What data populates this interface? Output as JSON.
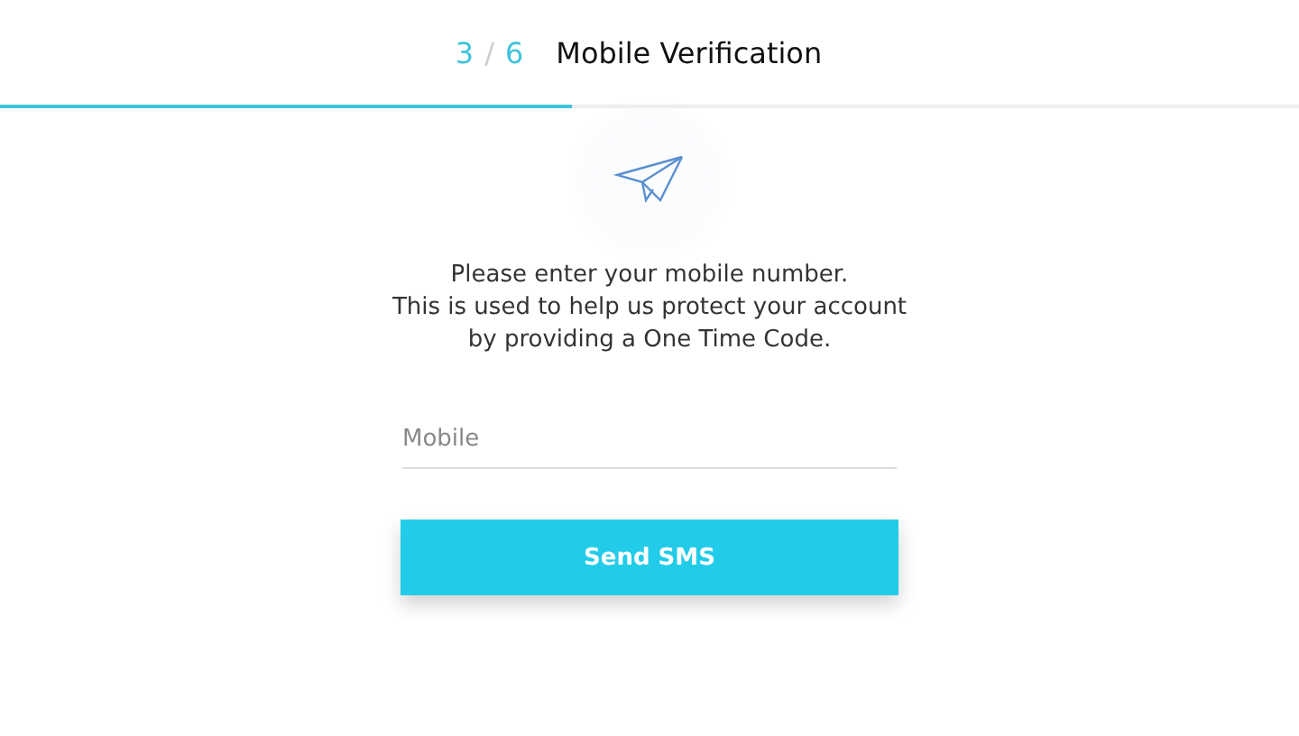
{
  "header": {
    "step_current": "3",
    "step_separator": "/",
    "step_total": "6",
    "title": "Mobile Verification"
  },
  "progress": {
    "level": 0.44
  },
  "message": [
    "Please enter your mobile number.",
    "This is used to help us protect your account",
    "by providing a One Time Code."
  ],
  "mobile_field": {
    "placeholder": "Mobile"
  },
  "button": {
    "label": "Send SMS"
  }
}
